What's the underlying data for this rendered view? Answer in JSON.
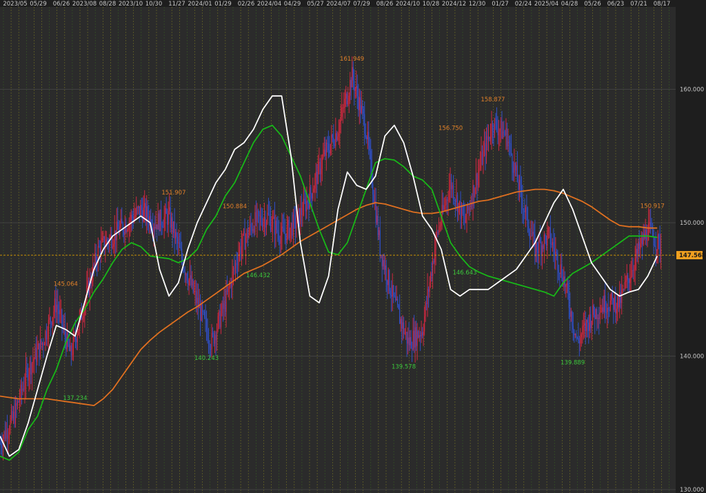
{
  "colors": {
    "background": "#2b2b2b",
    "axis_panel": "#1e1e1e",
    "grid": "#4a4a4a",
    "vgrid_dark": "#3b6b1f",
    "vgrid_light": "#8a8a20",
    "candle_up": "#d02840",
    "candle_down": "#3050c8",
    "ma_short": "#ffffff",
    "ma_mid": "#18b818",
    "ma_long": "#e07020",
    "current_line": "#e0a000",
    "current_tag": "#f0a020"
  },
  "chart_data": {
    "type": "line",
    "subtype": "candlestick with moving averages",
    "title": "",
    "xlabel": "",
    "ylabel": "",
    "ylim": [
      130,
      165
    ],
    "y_ticks": [
      "130.000",
      "140.000",
      "150.000",
      "160.000"
    ],
    "x_ticks": [
      "2023/05",
      "05/29",
      "06/26",
      "2023/08",
      "08/28",
      "2023/10",
      "10/30",
      "11/27",
      "2024/01",
      "01/29",
      "02/26",
      "2024/04",
      "04/29",
      "05/27",
      "2024/07",
      "07/29",
      "08/26",
      "2024/10",
      "10/28",
      "2024/12",
      "12/30",
      "01/27",
      "02/24",
      "2025/04",
      "04/28",
      "05/26",
      "06/23",
      "07/21",
      "08/17"
    ],
    "current_value": "147.568",
    "high_annotations": [
      {
        "x": 14,
        "value": "145.064"
      },
      {
        "x": 37,
        "value": "151.907"
      },
      {
        "x": 50,
        "value": "150.884"
      },
      {
        "x": 75,
        "value": "161.949"
      },
      {
        "x": 96,
        "value": "156.750"
      },
      {
        "x": 105,
        "value": "158.877"
      },
      {
        "x": 139,
        "value": "150.917"
      }
    ],
    "low_annotations": [
      {
        "x": 16,
        "value": "137.234"
      },
      {
        "x": 44,
        "value": "140.243"
      },
      {
        "x": 55,
        "value": "146.432"
      },
      {
        "x": 86,
        "value": "139.578"
      },
      {
        "x": 99,
        "value": "146.643"
      },
      {
        "x": 122,
        "value": "139.889"
      }
    ],
    "candle_x": [
      0,
      3,
      6,
      9,
      12,
      15,
      18,
      21,
      24,
      27,
      30,
      33,
      36,
      39,
      42,
      45,
      48,
      51,
      54,
      57,
      60,
      63,
      66,
      69,
      72,
      75,
      78,
      81,
      84,
      87,
      90,
      93,
      96,
      99,
      102,
      105,
      108,
      111,
      114,
      117,
      120,
      123,
      126,
      129,
      132,
      135,
      138,
      141
    ],
    "candle_close": [
      133.5,
      135.5,
      139,
      141,
      144,
      140,
      144,
      148,
      149,
      150,
      151,
      150,
      150.5,
      147,
      144,
      141,
      144,
      148,
      150,
      150.5,
      149,
      150,
      152,
      155,
      157,
      161,
      157,
      148,
      144,
      141,
      142,
      149,
      153,
      150,
      154,
      157.5,
      156.5,
      152,
      148,
      149,
      146,
      141,
      143,
      144,
      144,
      147,
      149.5,
      148
    ],
    "series": [
      {
        "x": [
          0,
          2,
          4,
          6,
          8,
          10,
          12,
          14,
          16,
          18,
          20,
          22,
          24,
          26,
          28,
          30,
          32,
          34,
          36,
          38,
          40,
          42,
          44,
          46,
          48,
          50,
          52,
          54,
          56,
          58,
          60,
          62,
          64,
          66,
          68,
          70,
          72,
          74,
          76,
          78,
          80,
          82,
          84,
          86,
          88,
          90,
          92,
          94,
          96,
          98,
          100,
          102,
          104,
          106,
          108,
          110,
          112,
          114,
          116,
          118,
          120,
          122,
          124,
          126,
          128,
          130,
          132,
          134,
          136,
          138,
          140
        ],
        "values": [
          134,
          132.5,
          133,
          135,
          137.5,
          140,
          142.3,
          142,
          141.5,
          144,
          146.5,
          148,
          149,
          149.5,
          150,
          150.5,
          150,
          146.5,
          144.5,
          145.5,
          148,
          150,
          151.5,
          153,
          154,
          155.5,
          156,
          157,
          158.5,
          159.5,
          159.5,
          155,
          148.5,
          144.5,
          144,
          146,
          151,
          153.8,
          152.8,
          152.5,
          153.5,
          156.5,
          157.3,
          156,
          153.5,
          150.5,
          149.5,
          148,
          145,
          144.5,
          145,
          145,
          145,
          145.5,
          146,
          146.5,
          147.5,
          148.5,
          150,
          151.5,
          152.5,
          151,
          149,
          147,
          146,
          145,
          144.5,
          144.8,
          145,
          146,
          147.5
        ]
      },
      {
        "x": [
          0,
          2,
          4,
          6,
          8,
          10,
          12,
          14,
          16,
          18,
          20,
          22,
          24,
          26,
          28,
          30,
          32,
          34,
          36,
          38,
          40,
          42,
          44,
          46,
          48,
          50,
          52,
          54,
          56,
          58,
          60,
          62,
          64,
          66,
          68,
          70,
          72,
          74,
          76,
          78,
          80,
          82,
          84,
          86,
          88,
          90,
          92,
          94,
          96,
          98,
          100,
          102,
          104,
          106,
          108,
          110,
          112,
          114,
          116,
          118,
          120,
          122,
          124,
          126,
          128,
          130,
          132,
          134,
          136,
          138,
          140
        ],
        "values": [
          132.5,
          132.2,
          132.8,
          134.5,
          135.5,
          137.5,
          139,
          141,
          142.5,
          143.5,
          144.8,
          145.8,
          147,
          148,
          148.5,
          148.2,
          147.5,
          147.4,
          147.3,
          147,
          147.3,
          148,
          149.5,
          150.5,
          152,
          153,
          154.5,
          156,
          157,
          157.3,
          156.5,
          155,
          153.5,
          151.5,
          149.5,
          147.8,
          147.6,
          148.5,
          150.5,
          152.5,
          154.5,
          154.8,
          154.7,
          154.2,
          153.5,
          153.2,
          152.5,
          150.5,
          148.5,
          147.5,
          146.7,
          146.3,
          146,
          145.8,
          145.6,
          145.4,
          145.2,
          145,
          144.8,
          144.5,
          145.5,
          146.2,
          146.6,
          147,
          147.5,
          148,
          148.5,
          149,
          149,
          149,
          148.9
        ]
      },
      {
        "x": [
          0,
          2,
          4,
          6,
          8,
          10,
          12,
          14,
          16,
          18,
          20,
          22,
          24,
          26,
          28,
          30,
          32,
          34,
          36,
          38,
          40,
          42,
          44,
          46,
          48,
          50,
          52,
          54,
          56,
          58,
          60,
          62,
          64,
          66,
          68,
          70,
          72,
          74,
          76,
          78,
          80,
          82,
          84,
          86,
          88,
          90,
          92,
          94,
          96,
          98,
          100,
          102,
          104,
          106,
          108,
          110,
          112,
          114,
          116,
          118,
          120,
          122,
          124,
          126,
          128,
          130,
          132,
          134,
          136,
          138,
          140
        ],
        "values": [
          137,
          136.9,
          136.8,
          136.8,
          136.8,
          136.8,
          136.7,
          136.6,
          136.5,
          136.4,
          136.3,
          136.8,
          137.5,
          138.5,
          139.5,
          140.5,
          141.2,
          141.8,
          142.3,
          142.8,
          143.3,
          143.7,
          144.2,
          144.7,
          145.2,
          145.7,
          146.2,
          146.5,
          146.8,
          147.2,
          147.6,
          148.1,
          148.6,
          149,
          149.4,
          149.8,
          150.2,
          150.6,
          151,
          151.3,
          151.5,
          151.4,
          151.2,
          151,
          150.8,
          150.7,
          150.7,
          150.8,
          151,
          151.2,
          151.4,
          151.6,
          151.7,
          151.9,
          152.1,
          152.3,
          152.4,
          152.5,
          152.5,
          152.4,
          152.2,
          151.9,
          151.6,
          151.2,
          150.7,
          150.2,
          149.8,
          149.7,
          149.7,
          149.6,
          149.6
        ]
      }
    ]
  }
}
